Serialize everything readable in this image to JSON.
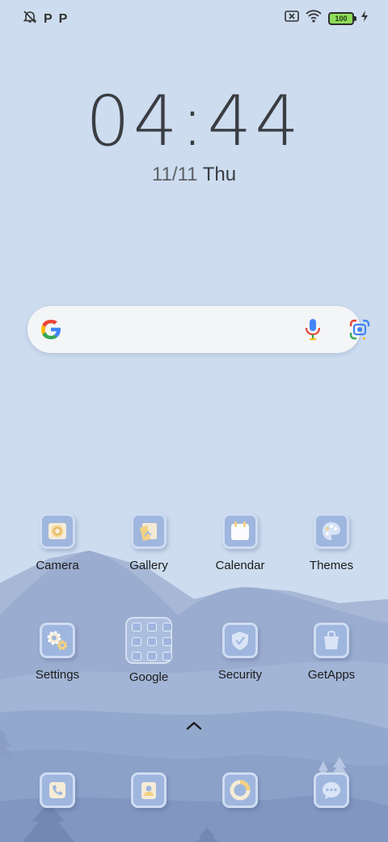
{
  "status_bar": {
    "left_icons": [
      "alarm-off-icon",
      "p-notification-icon",
      "p-notification-icon"
    ],
    "p_glyph": "P",
    "right_icons": [
      "sim-error-icon",
      "wifi-icon",
      "battery-icon",
      "charging-icon"
    ],
    "battery_level": "100"
  },
  "clock": {
    "time": "04:44",
    "date": "11/11",
    "day": "Thu"
  },
  "search": {
    "icons": [
      "google-g-icon",
      "microphone-icon",
      "google-lens-icon"
    ]
  },
  "apps": {
    "row1": [
      {
        "label": "Camera",
        "icon": "camera-icon"
      },
      {
        "label": "Gallery",
        "icon": "gallery-icon"
      },
      {
        "label": "Calendar",
        "icon": "calendar-icon"
      },
      {
        "label": "Themes",
        "icon": "palette-icon"
      }
    ],
    "row2": [
      {
        "label": "Settings",
        "icon": "gear-icon"
      },
      {
        "label": "Google",
        "icon": "folder-icon"
      },
      {
        "label": "Security",
        "icon": "shield-icon"
      },
      {
        "label": "GetApps",
        "icon": "shopping-bag-icon"
      }
    ]
  },
  "dock": [
    {
      "icon": "phone-icon"
    },
    {
      "icon": "contacts-icon"
    },
    {
      "icon": "browser-icon"
    },
    {
      "icon": "messages-icon"
    }
  ],
  "app_drawer_icon": "chevron-up-icon",
  "colors": {
    "sky": "#cddcef",
    "mountain_far": "#9aaccf",
    "mountain_near": "#8da2c8",
    "icon_tile": "#9fb6de",
    "label_text": "#1b1b1b"
  }
}
